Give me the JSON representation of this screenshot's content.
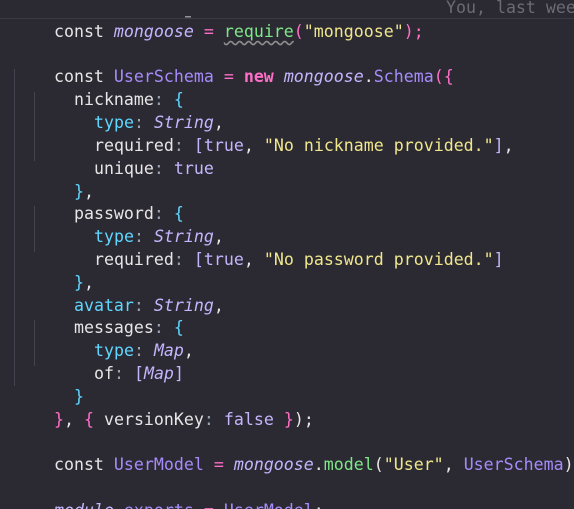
{
  "editor": {
    "ghost_text": "You, last wee",
    "lines": [
      {
        "tokens": [
          "const",
          "mongoose",
          "=",
          "require",
          "(",
          "\"mongoose\"",
          ");"
        ]
      },
      {
        "tokens": []
      },
      {
        "tokens": [
          "const",
          "UserSchema",
          "=",
          "new",
          "mongoose",
          ".",
          "Schema",
          "(",
          "{"
        ]
      },
      {
        "tokens": [
          "nickname",
          ":",
          "{"
        ]
      },
      {
        "tokens": [
          "type",
          ":",
          "String",
          ","
        ]
      },
      {
        "tokens": [
          "required",
          ":",
          "[",
          "true",
          ",",
          "\"No nickname provided.\"",
          "]",
          ","
        ]
      },
      {
        "tokens": [
          "unique",
          ":",
          "true"
        ]
      },
      {
        "tokens": [
          "}",
          ","
        ]
      },
      {
        "tokens": [
          "password",
          ":",
          "{"
        ]
      },
      {
        "tokens": [
          "type",
          ":",
          "String",
          ","
        ]
      },
      {
        "tokens": [
          "required",
          ":",
          "[",
          "true",
          ",",
          "\"No password provided.\"",
          "]"
        ]
      },
      {
        "tokens": [
          "}",
          ","
        ]
      },
      {
        "tokens": [
          "avatar",
          ":",
          "String",
          ","
        ]
      },
      {
        "tokens": [
          "messages",
          ":",
          "{"
        ]
      },
      {
        "tokens": [
          "type",
          ":",
          "Map",
          ","
        ]
      },
      {
        "tokens": [
          "of",
          ":",
          "[",
          "Map",
          "]"
        ]
      },
      {
        "tokens": [
          "}"
        ]
      },
      {
        "tokens": [
          "}",
          ",",
          "{",
          "versionKey",
          ":",
          "false",
          "}",
          ");"
        ]
      },
      {
        "tokens": []
      },
      {
        "tokens": [
          "const",
          "UserModel",
          "=",
          "mongoose",
          ".",
          "model",
          "(",
          "\"User\"",
          ",",
          "UserSchema",
          ");"
        ]
      },
      {
        "tokens": []
      },
      {
        "tokens": [
          "module",
          ".",
          "exports",
          "=",
          "UserModel",
          ";"
        ]
      }
    ]
  },
  "colors": {
    "background": "#2b2a33",
    "keyword_new": "#ff6ec7",
    "string": "#f0e68c",
    "italic_identifier": "#c4b5fd",
    "method": "#a78bfa",
    "brace_cyan": "#5fd7ff",
    "ghost": "#6b6a75"
  }
}
